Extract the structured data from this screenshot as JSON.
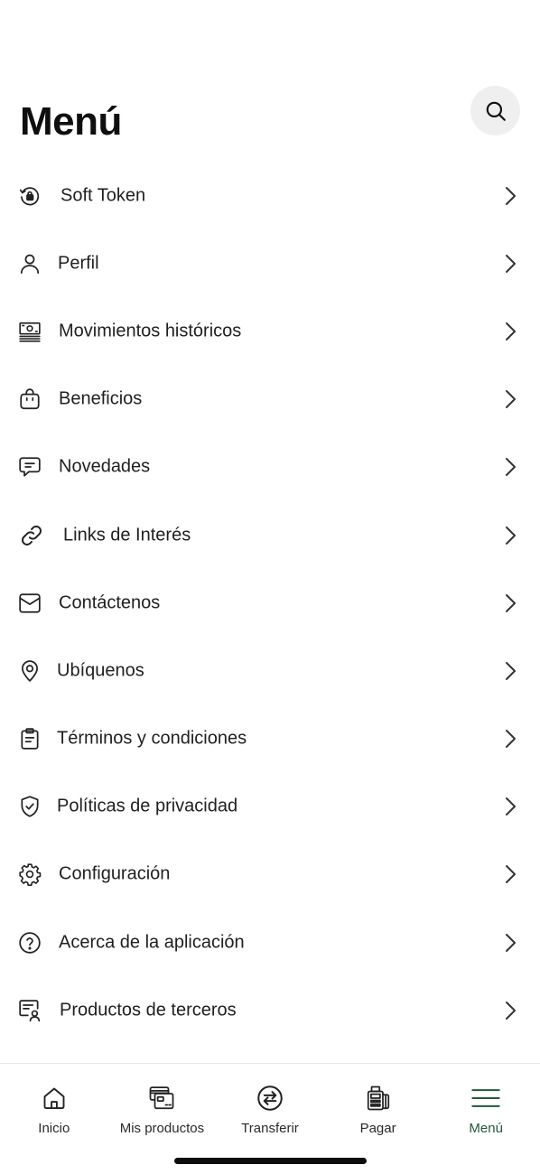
{
  "header": {
    "title": "Menú",
    "search_icon": "search-icon"
  },
  "menu": {
    "items": [
      {
        "label": "Soft Token",
        "icon": "soft-token-icon"
      },
      {
        "label": "Perfil",
        "icon": "user-icon"
      },
      {
        "label": "Movimientos históricos",
        "icon": "banknote-history-icon"
      },
      {
        "label": "Beneficios",
        "icon": "shopping-bag-icon"
      },
      {
        "label": "Novedades",
        "icon": "message-icon"
      },
      {
        "label": "Links de Interés",
        "icon": "link-icon"
      },
      {
        "label": "Contáctenos",
        "icon": "mail-icon"
      },
      {
        "label": "Ubíquenos",
        "icon": "location-pin-icon"
      },
      {
        "label": "Términos y condiciones",
        "icon": "clipboard-icon"
      },
      {
        "label": "Políticas de privacidad",
        "icon": "shield-check-icon"
      },
      {
        "label": "Configuración",
        "icon": "gear-icon"
      },
      {
        "label": "Acerca de la aplicación",
        "icon": "help-circle-icon"
      },
      {
        "label": "Productos de terceros",
        "icon": "third-party-products-icon"
      }
    ],
    "chevron_icon": "chevron-right-icon"
  },
  "tabbar": {
    "tabs": [
      {
        "label": "Inicio",
        "icon": "home-icon",
        "active": false
      },
      {
        "label": "Mis productos",
        "icon": "cards-icon",
        "active": false
      },
      {
        "label": "Transferir",
        "icon": "transfer-icon",
        "active": false
      },
      {
        "label": "Pagar",
        "icon": "pay-terminal-icon",
        "active": false
      },
      {
        "label": "Menú",
        "icon": "hamburger-menu-icon",
        "active": true
      }
    ]
  },
  "colors": {
    "accent": "#1f5a3c",
    "text": "#1f1f1f",
    "search_bg": "#efefef",
    "background": "#ffffff"
  }
}
